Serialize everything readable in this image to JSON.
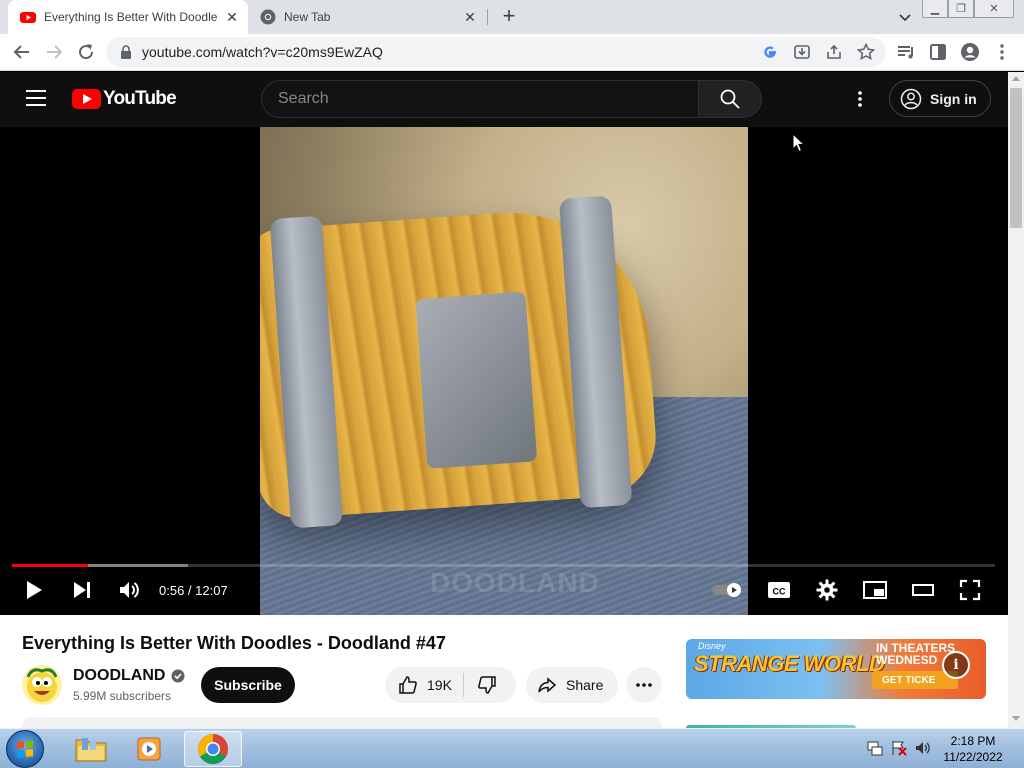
{
  "browser": {
    "tabs": [
      {
        "title": "Everything Is Better With Doodle",
        "active": true,
        "favicon": "youtube-icon"
      },
      {
        "title": "New Tab",
        "active": false,
        "favicon": "chrome-icon"
      }
    ],
    "new_tab_symbol": "+",
    "url": "youtube.com/watch?v=c20ms9EwZAQ"
  },
  "youtube": {
    "logo_text": "YouTube",
    "search_placeholder": "Search",
    "sign_in": "Sign in"
  },
  "player": {
    "time_display": "0:56 / 12:07",
    "played_fraction": 0.077,
    "buffered_fraction": 0.179,
    "watermark": "DOODLAND"
  },
  "video": {
    "title": "Everything Is Better With Doodles - Doodland #47",
    "channel": "DOODLAND",
    "subscribers": "5.99M subscribers",
    "subscribe_label": "Subscribe",
    "likes": "19K",
    "share_label": "Share"
  },
  "ad": {
    "brand": "Disney",
    "movie": "STRANGE WORLD",
    "theaters": "IN THEATERS",
    "day": "WEDNESD",
    "cta": "GET TICKE"
  },
  "taskbar": {
    "time": "2:18 PM",
    "date": "11/22/2022"
  },
  "colors": {
    "yt_red": "#ff0000",
    "masthead_bg": "#0f0f0f",
    "taskbar": "#a3c0e0"
  }
}
